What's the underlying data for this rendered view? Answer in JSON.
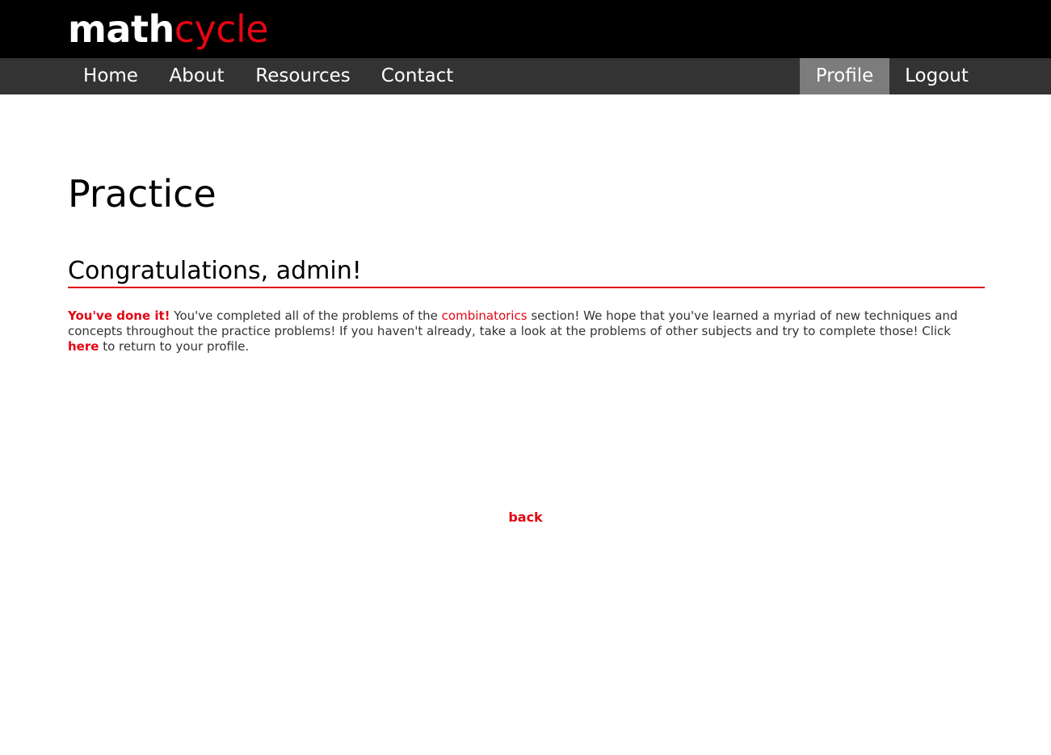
{
  "header": {
    "logo_main": "math",
    "logo_accent": "cycle"
  },
  "nav": {
    "home": "Home",
    "about": "About",
    "resources": "Resources",
    "contact": "Contact",
    "profile": "Profile",
    "logout": "Logout",
    "active": "Profile"
  },
  "main": {
    "title": "Practice",
    "heading": "Congratulations, admin!",
    "message": {
      "lead": "You've done it!",
      "part1": " You've completed all of the problems of the ",
      "subject_link": "combinatorics",
      "part2": " section! We hope that you've learned a myriad of new techniques and concepts throughout the practice problems! If you haven't already, take a look at the problems of other subjects and try to complete those! Click ",
      "here_link": "here",
      "part3": " to return to your profile."
    },
    "back_link": "back"
  },
  "colors": {
    "accent": "#e30613",
    "topbar": "#000000",
    "navbar": "#333333",
    "nav_active": "#7c7c7c"
  }
}
